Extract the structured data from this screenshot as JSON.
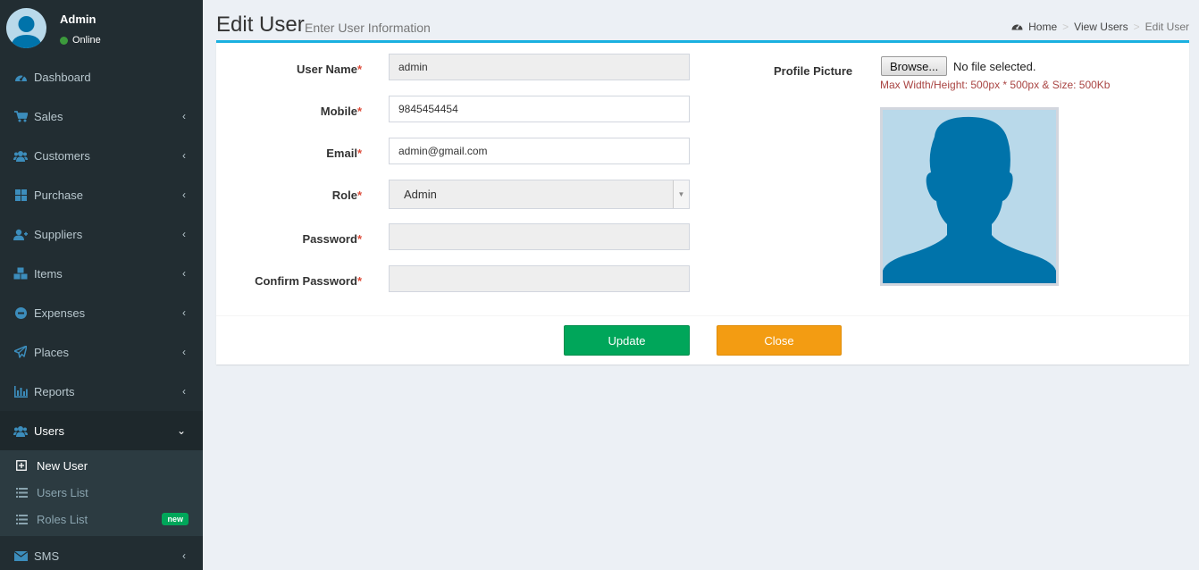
{
  "user": {
    "name": "Admin",
    "status": "Online"
  },
  "sidebar": {
    "items": [
      {
        "label": "Dashboard",
        "icon": "dashboard-icon"
      },
      {
        "label": "Sales",
        "icon": "cart-icon"
      },
      {
        "label": "Customers",
        "icon": "users-icon"
      },
      {
        "label": "Purchase",
        "icon": "grid-icon"
      },
      {
        "label": "Suppliers",
        "icon": "user-plus-icon"
      },
      {
        "label": "Items",
        "icon": "cubes-icon"
      },
      {
        "label": "Expenses",
        "icon": "minus-circle-icon"
      },
      {
        "label": "Places",
        "icon": "paper-plane-icon"
      },
      {
        "label": "Reports",
        "icon": "bar-chart-icon"
      },
      {
        "label": "Users",
        "icon": "users-icon"
      },
      {
        "label": "SMS",
        "icon": "envelope-icon"
      }
    ],
    "submenu": [
      {
        "label": "New User",
        "icon": "plus-square-icon"
      },
      {
        "label": "Users List",
        "icon": "list-icon"
      },
      {
        "label": "Roles List",
        "icon": "list-icon",
        "badge": "new"
      }
    ]
  },
  "header": {
    "title": "Edit User",
    "subtitle": "Enter User Information",
    "breadcrumb": [
      "Home",
      "View Users",
      "Edit User"
    ]
  },
  "form": {
    "username_label": "User Name",
    "username_value": "admin",
    "mobile_label": "Mobile",
    "mobile_value": "9845454454",
    "email_label": "Email",
    "email_value": "admin@gmail.com",
    "role_label": "Role",
    "role_value": "Admin",
    "password_label": "Password",
    "confirm_label": "Confirm Password",
    "required_mark": "*"
  },
  "profile": {
    "label": "Profile Picture",
    "browse": "Browse...",
    "file_status": "No file selected.",
    "hint": "Max Width/Height: 500px * 500px & Size: 500Kb"
  },
  "buttons": {
    "update": "Update",
    "close": "Close"
  },
  "colors": {
    "sidebar": "#222d32",
    "accent": "#1ab0e0",
    "update": "#00a65a",
    "close": "#f39c12"
  }
}
